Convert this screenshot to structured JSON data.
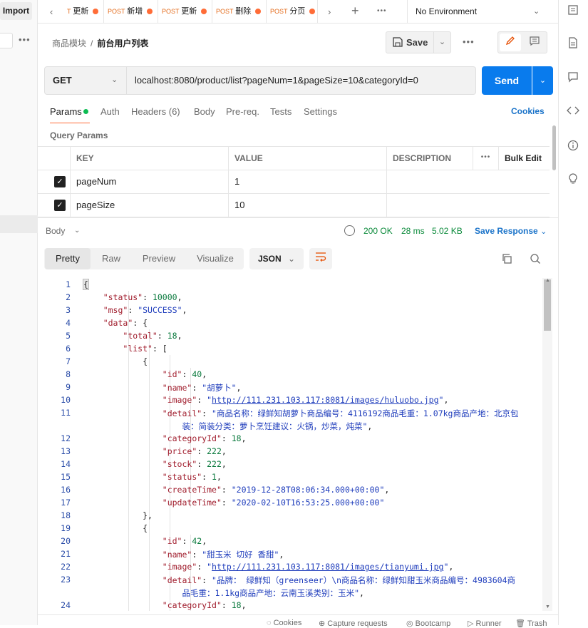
{
  "sidebar": {
    "import_label": "Import",
    "more": "•••"
  },
  "tabs": {
    "items": [
      {
        "method": "T",
        "title": "更新"
      },
      {
        "method": "POST",
        "title": "新增"
      },
      {
        "method": "POST",
        "title": "更新"
      },
      {
        "method": "POST",
        "title": "删除"
      },
      {
        "method": "POST",
        "title": "分页"
      }
    ],
    "environment": "No Environment"
  },
  "header": {
    "breadcrumb_parent": "商品模块",
    "breadcrumb_sep": "/",
    "breadcrumb_current": "前台用户列表",
    "save_label": "Save"
  },
  "request": {
    "method": "GET",
    "url": "localhost:8080/product/list?pageNum=1&pageSize=10&categoryId=0",
    "send_label": "Send",
    "tabs": {
      "params": "Params",
      "auth": "Auth",
      "headers": "Headers (6)",
      "body": "Body",
      "prereq": "Pre-req.",
      "tests": "Tests",
      "settings": "Settings"
    },
    "cookies_label": "Cookies",
    "query_title": "Query Params",
    "columns": {
      "key": "KEY",
      "value": "VALUE",
      "description": "DESCRIPTION",
      "bulk": "Bulk Edit"
    },
    "params": [
      {
        "key": "pageNum",
        "value": "1",
        "checked": true
      },
      {
        "key": "pageSize",
        "value": "10",
        "checked": true
      }
    ]
  },
  "response": {
    "body_label": "Body",
    "status": "200 OK",
    "time": "28 ms",
    "size": "5.02 KB",
    "save_label": "Save Response",
    "views": {
      "pretty": "Pretty",
      "raw": "Raw",
      "preview": "Preview",
      "visualize": "Visualize"
    },
    "format": "JSON"
  },
  "code": {
    "line_numbers": [
      "1",
      "2",
      "3",
      "4",
      "5",
      "6",
      "7",
      "8",
      "9",
      "10",
      "11",
      "",
      "12",
      "13",
      "14",
      "15",
      "16",
      "17",
      "18",
      "19",
      "20",
      "21",
      "22",
      "23",
      "",
      "24"
    ],
    "key_status": "\"status\"",
    "val_status": "10000",
    "key_msg": "\"msg\"",
    "val_msg": "\"SUCCESS\"",
    "key_data": "\"data\"",
    "key_total": "\"total\"",
    "val_total": "18",
    "key_list": "\"list\"",
    "key_id": "\"id\"",
    "key_name": "\"name\"",
    "key_image": "\"image\"",
    "key_detail": "\"detail\"",
    "key_categoryId": "\"categoryId\"",
    "key_price": "\"price\"",
    "key_stock": "\"stock\"",
    "key_createTime": "\"createTime\"",
    "key_updateTime": "\"updateTime\"",
    "item1": {
      "id": "40",
      "name": "\"胡萝卜\"",
      "image": "http://111.231.103.117:8081/images/huluobo.jpg",
      "detail_1": "\"商品名称：绿鲜知胡萝卜商品编号：4116192商品毛重：1.07kg商品产地：北京包",
      "detail_2": "装：简装分类：萝卜烹饪建议：火锅，炒菜，炖菜\"",
      "categoryId": "18",
      "price": "222",
      "stock": "222",
      "status": "1",
      "createTime": "\"2019-12-28T08:06:34.000+00:00\"",
      "updateTime": "\"2020-02-10T16:53:25.000+00:00\""
    },
    "item2": {
      "id": "42",
      "name": "\"甜玉米 切好 香甜\"",
      "image": "http://111.231.103.117:8081/images/tianyumi.jpg",
      "detail_1": "\"品牌： 绿鲜知（greenseer）\\n商品名称：绿鲜知甜玉米商品编号：4983604商",
      "detail_2": "品毛重：1.1kg商品产地：云南玉溪类别：玉米\"",
      "categoryId": "18"
    }
  },
  "footer": {
    "cookies": "Cookies",
    "capture": "Capture requests",
    "bootcamp": "Bootcamp",
    "runner": "Runner",
    "trash": "Trash"
  }
}
